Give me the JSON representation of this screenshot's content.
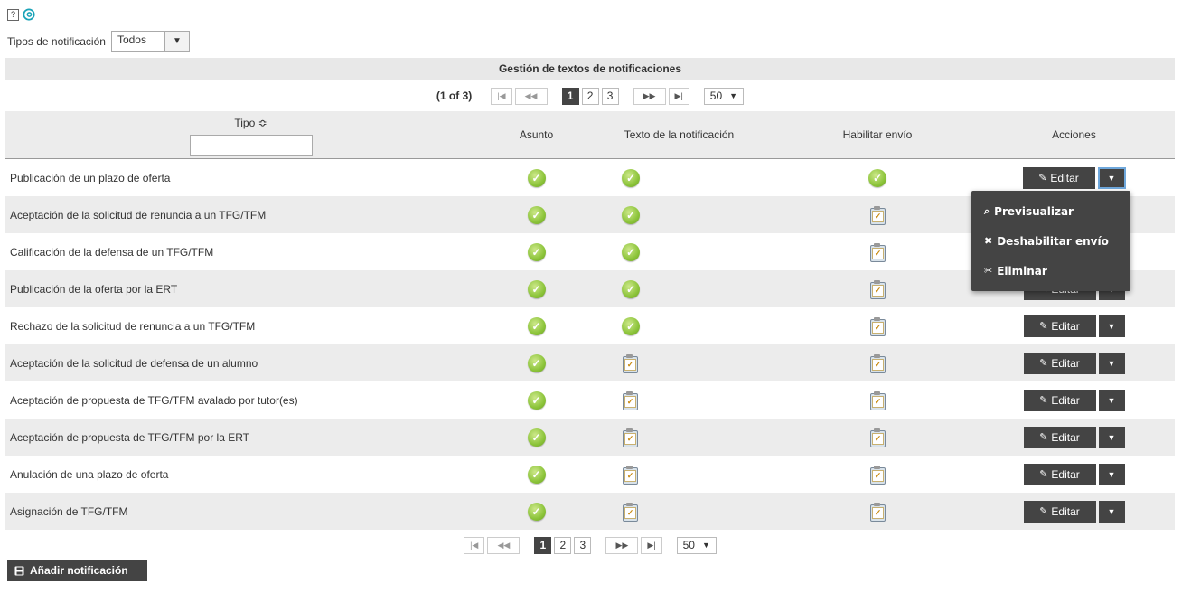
{
  "top": {
    "help_label": "?",
    "at_symbol": "@"
  },
  "filter": {
    "label": "Tipos de notificación",
    "value": "Todos"
  },
  "table": {
    "title": "Gestión de textos de notificaciones",
    "pagination": {
      "current": "(1 of 3)",
      "first": "|◀",
      "prev": "◀◀",
      "next": "▶▶",
      "last": "▶|",
      "pages": [
        "1",
        "2",
        "3"
      ],
      "per_page": "50"
    },
    "columns": {
      "tipo": "Tipo ≎",
      "asunto": "Asunto",
      "texto": "Texto de la notificación",
      "habilitar": "Habilitar envío",
      "acciones": "Acciones"
    },
    "edit_label": "Editar",
    "rows": [
      {
        "tipo": "Publicación de un plazo de oferta",
        "asunto": "ok",
        "texto": "ok",
        "habilitar": "ok"
      },
      {
        "tipo": "Aceptación de la solicitud de renuncia a un TFG/TFM",
        "asunto": "ok",
        "texto": "ok",
        "habilitar": "checklist"
      },
      {
        "tipo": "Calificación de la defensa de un TFG/TFM",
        "asunto": "ok",
        "texto": "ok",
        "habilitar": "checklist"
      },
      {
        "tipo": "Publicación de la oferta por la ERT",
        "asunto": "ok",
        "texto": "ok",
        "habilitar": "checklist"
      },
      {
        "tipo": "Rechazo de la solicitud de renuncia a un TFG/TFM",
        "asunto": "ok",
        "texto": "ok",
        "habilitar": "checklist"
      },
      {
        "tipo": "Aceptación de la solicitud de defensa de un alumno",
        "asunto": "ok",
        "texto": "checklist",
        "habilitar": "checklist"
      },
      {
        "tipo": "Aceptación de propuesta de TFG/TFM avalado por tutor(es)",
        "asunto": "ok",
        "texto": "checklist",
        "habilitar": "checklist"
      },
      {
        "tipo": "Aceptación de propuesta de TFG/TFM por la ERT",
        "asunto": "ok",
        "texto": "checklist",
        "habilitar": "checklist"
      },
      {
        "tipo": "Anulación de una plazo de oferta",
        "asunto": "ok",
        "texto": "checklist",
        "habilitar": "checklist"
      },
      {
        "tipo": "Asignación de TFG/TFM",
        "asunto": "ok",
        "texto": "checklist",
        "habilitar": "checklist"
      }
    ]
  },
  "dropdown": {
    "items": [
      {
        "icon": "search-icon",
        "glyph": "⌕",
        "label": "Previsualizar"
      },
      {
        "icon": "close-icon",
        "glyph": "✖",
        "label": "Deshabilitar envío"
      },
      {
        "icon": "scissors-icon",
        "glyph": "✂",
        "label": "Eliminar"
      }
    ]
  },
  "add_button": {
    "label": "Añadir notificación",
    "icon": "save-icon"
  },
  "colors": {
    "dark": "#444444",
    "header_bg": "#ececec",
    "ok_green": "#8cc43a",
    "focus_blue": "#6fa8dc"
  }
}
